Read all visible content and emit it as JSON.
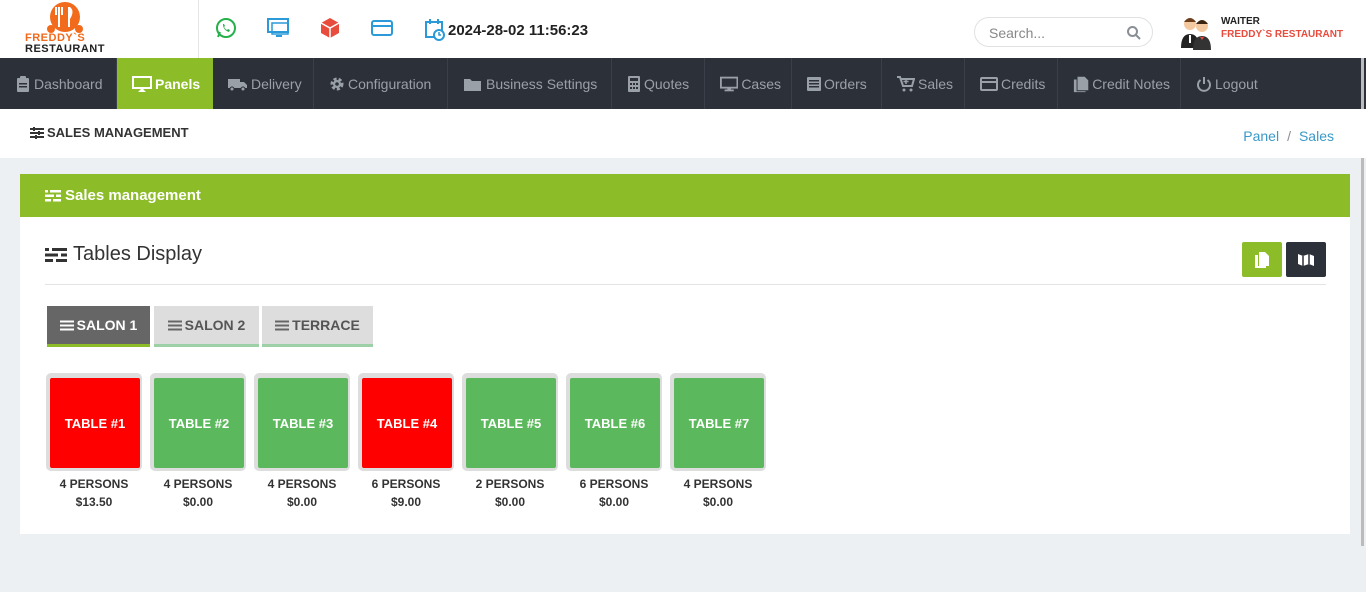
{
  "brand": {
    "line1": "FREDDY`S",
    "line2": "RESTAURANT",
    "accent": "#f26a1b"
  },
  "header": {
    "datetime": "2024-28-02 11:56:23",
    "search_placeholder": "Search...",
    "user_role": "WAITER",
    "user_restaurant": "FREDDY`S RESTAURANT",
    "quick_icons": [
      "whatsapp-icon",
      "monitor-icon",
      "box-icon",
      "card-icon"
    ]
  },
  "nav": [
    {
      "label": "Dashboard",
      "icon": "clipboard-icon"
    },
    {
      "label": "Panels",
      "icon": "tv-icon",
      "active": true
    },
    {
      "label": "Delivery",
      "icon": "truck-icon"
    },
    {
      "label": "Configuration",
      "icon": "gear-icon"
    },
    {
      "label": "Business Settings",
      "icon": "folder-icon"
    },
    {
      "label": "Quotes",
      "icon": "calculator-icon"
    },
    {
      "label": "Cases",
      "icon": "desktop-icon"
    },
    {
      "label": "Orders",
      "icon": "list-icon"
    },
    {
      "label": "Sales",
      "icon": "cart-icon"
    },
    {
      "label": "Credits",
      "icon": "credit-card-icon"
    },
    {
      "label": "Credit Notes",
      "icon": "files-icon"
    },
    {
      "label": "Logout",
      "icon": "power-icon"
    }
  ],
  "page": {
    "title": "SALES MANAGEMENT",
    "breadcrumb": [
      "Panel",
      "Sales"
    ]
  },
  "card": {
    "title": "Sales management",
    "section_title": "Tables Display"
  },
  "tabs": [
    {
      "label": "SALON 1",
      "active": true
    },
    {
      "label": "SALON 2",
      "active": false
    },
    {
      "label": "TERRACE",
      "active": false
    }
  ],
  "tables": [
    {
      "name": "TABLE #1",
      "persons": "4 PERSONS",
      "amount": "$13.50",
      "status": "occupied"
    },
    {
      "name": "TABLE #2",
      "persons": "4 PERSONS",
      "amount": "$0.00",
      "status": "free"
    },
    {
      "name": "TABLE #3",
      "persons": "4 PERSONS",
      "amount": "$0.00",
      "status": "free"
    },
    {
      "name": "TABLE #4",
      "persons": "6 PERSONS",
      "amount": "$9.00",
      "status": "occupied"
    },
    {
      "name": "TABLE #5",
      "persons": "2 PERSONS",
      "amount": "$0.00",
      "status": "free"
    },
    {
      "name": "TABLE #6",
      "persons": "6 PERSONS",
      "amount": "$0.00",
      "status": "free"
    },
    {
      "name": "TABLE #7",
      "persons": "4 PERSONS",
      "amount": "$0.00",
      "status": "free"
    }
  ],
  "colors": {
    "primary": "#8cbc28",
    "occupied": "#ff0000",
    "free": "#5cb85c",
    "nav_bg": "#2c3039"
  }
}
